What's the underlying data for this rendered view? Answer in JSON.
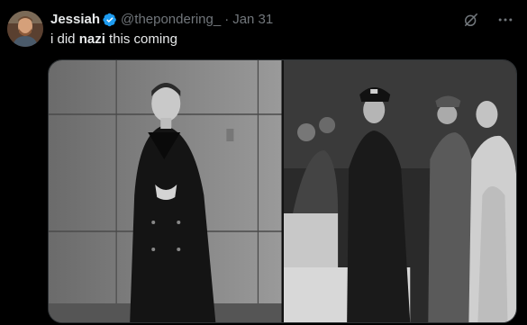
{
  "tweet": {
    "display_name": "Jessiah",
    "handle": "@thepondering_",
    "separator": "·",
    "date": "Jan 31",
    "text_before": "i did ",
    "text_bold": "nazi",
    "text_after": " this coming"
  },
  "icons": {
    "verified": "verified-badge-icon",
    "grok": "grok-icon",
    "more": "more-options-icon"
  },
  "colors": {
    "background": "#000000",
    "primary_text": "#e7e9ea",
    "secondary_text": "#71767b",
    "verified_badge": "#1d9bf0"
  },
  "media": {
    "count": 2
  }
}
